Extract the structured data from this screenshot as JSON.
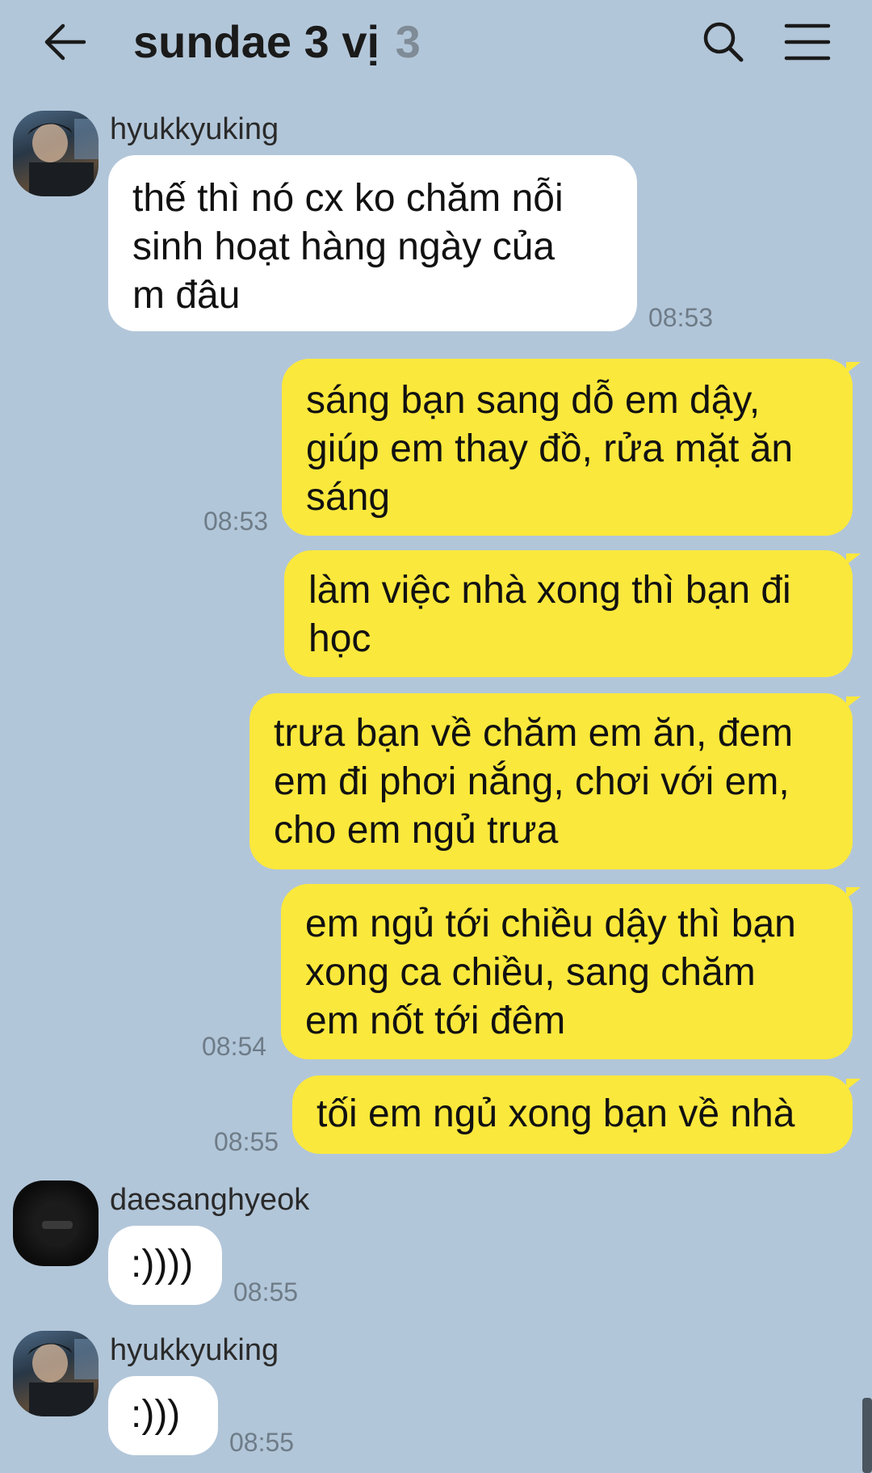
{
  "header": {
    "back_icon": "arrow-left-icon",
    "title": "sundae 3 vị",
    "member_count": "3",
    "search_icon": "search-icon",
    "menu_icon": "hamburger-menu-icon"
  },
  "messages": [
    {
      "sender": "hyukkyuking",
      "direction": "in",
      "lines": [
        "thế thì nó cx ko chăm nỗi",
        "sinh hoạt hàng ngày của",
        "m đâu"
      ],
      "time": "08:53"
    },
    {
      "direction": "out",
      "lines": [
        "sáng bạn sang dỗ em dậy,",
        "giúp em thay đồ, rửa mặt ăn",
        "sáng"
      ],
      "time": "08:53"
    },
    {
      "direction": "out",
      "lines": [
        "làm việc nhà xong thì bạn đi",
        "học"
      ],
      "time": ""
    },
    {
      "direction": "out",
      "lines": [
        "trưa bạn về chăm em ăn, đem",
        "em đi phơi nắng, chơi với em,",
        "cho em ngủ trưa"
      ],
      "time": ""
    },
    {
      "direction": "out",
      "lines": [
        "em ngủ tới chiều dậy thì bạn",
        "xong ca chiều, sang chăm",
        "em nốt tới đêm"
      ],
      "time": "08:54"
    },
    {
      "direction": "out",
      "lines": [
        "tối em ngủ xong bạn về nhà"
      ],
      "time": "08:55"
    },
    {
      "sender": "daesanghyeok",
      "direction": "in",
      "lines": [
        ":))))"
      ],
      "time": "08:55"
    },
    {
      "sender": "hyukkyuking",
      "direction": "in",
      "lines": [
        ":)))"
      ],
      "time": "08:55"
    }
  ],
  "colors": {
    "background": "#b2c6d9",
    "outgoing_bubble": "#fbe83c",
    "incoming_bubble": "#ffffff",
    "timestamp": "#6e7c88"
  }
}
